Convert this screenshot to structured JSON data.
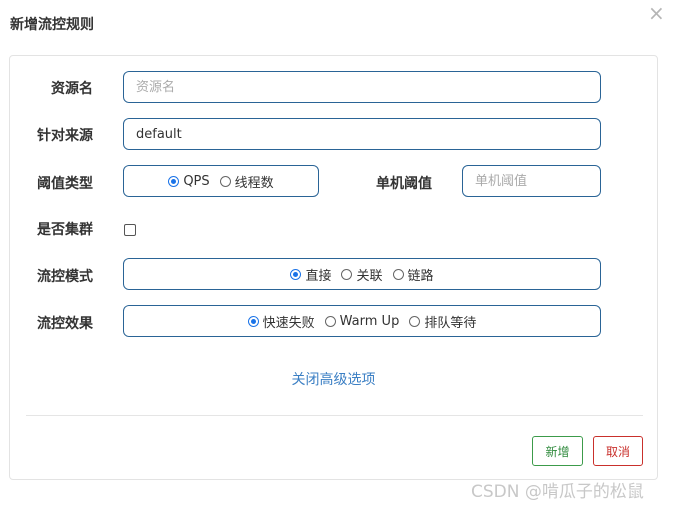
{
  "dialog": {
    "title": "新增流控规则",
    "close_glyph": "×"
  },
  "form": {
    "resource": {
      "label": "资源名",
      "placeholder": "资源名",
      "value": ""
    },
    "origin": {
      "label": "针对来源",
      "value": "default"
    },
    "threshold_type": {
      "label": "阈值类型",
      "options": [
        "QPS",
        "线程数"
      ],
      "selected": "QPS"
    },
    "threshold": {
      "label": "单机阈值",
      "placeholder": "单机阈值",
      "value": ""
    },
    "cluster": {
      "label": "是否集群",
      "checked": false
    },
    "control_mode": {
      "label": "流控模式",
      "options": [
        "直接",
        "关联",
        "链路"
      ],
      "selected": "直接"
    },
    "control_effect": {
      "label": "流控效果",
      "options": [
        "快速失败",
        "Warm Up",
        "排队等待"
      ],
      "selected": "快速失败"
    }
  },
  "advanced_link": "关闭高级选项",
  "buttons": {
    "add": "新增",
    "cancel": "取消"
  },
  "watermark": "CSDN @啃瓜子的松鼠",
  "colors": {
    "input_border": "#2a6496",
    "radio_checked": "#1a73e8",
    "link": "#3b7fc4",
    "add_button": "#3c9b4a",
    "cancel_button": "#c9302c"
  }
}
